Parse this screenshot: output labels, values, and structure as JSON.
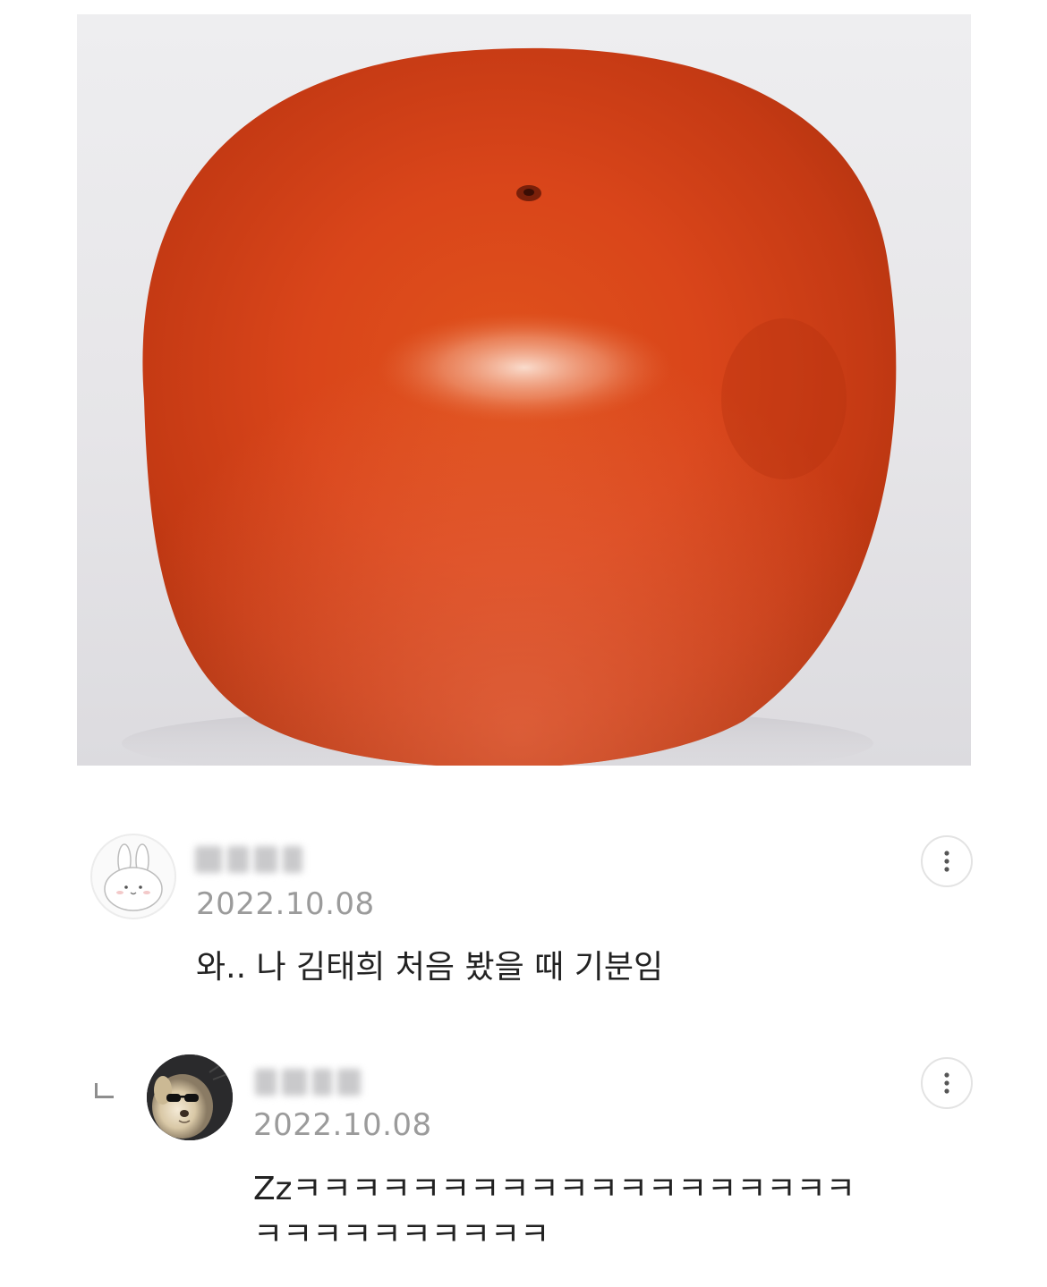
{
  "post": {
    "image_description": "tomato-photo"
  },
  "comments": [
    {
      "date": "2022.10.08",
      "text": "와.. 나 김태희 처음 봤을 때 기분임",
      "avatar_icon": "bunny-avatar-icon",
      "more_icon": "more-vertical-icon"
    },
    {
      "date": "2022.10.08",
      "text_line1": "Zzㅋㅋㅋㅋㅋㅋㅋㅋㅋㅋㅋㅋㅋㅋㅋㅋㅋㅋㅋ",
      "text_line2": "ㅋㅋㅋㅋㅋㅋㅋㅋㅋㅋ",
      "avatar_icon": "dog-sunglasses-avatar-icon",
      "more_icon": "more-vertical-icon",
      "is_reply": true
    }
  ]
}
